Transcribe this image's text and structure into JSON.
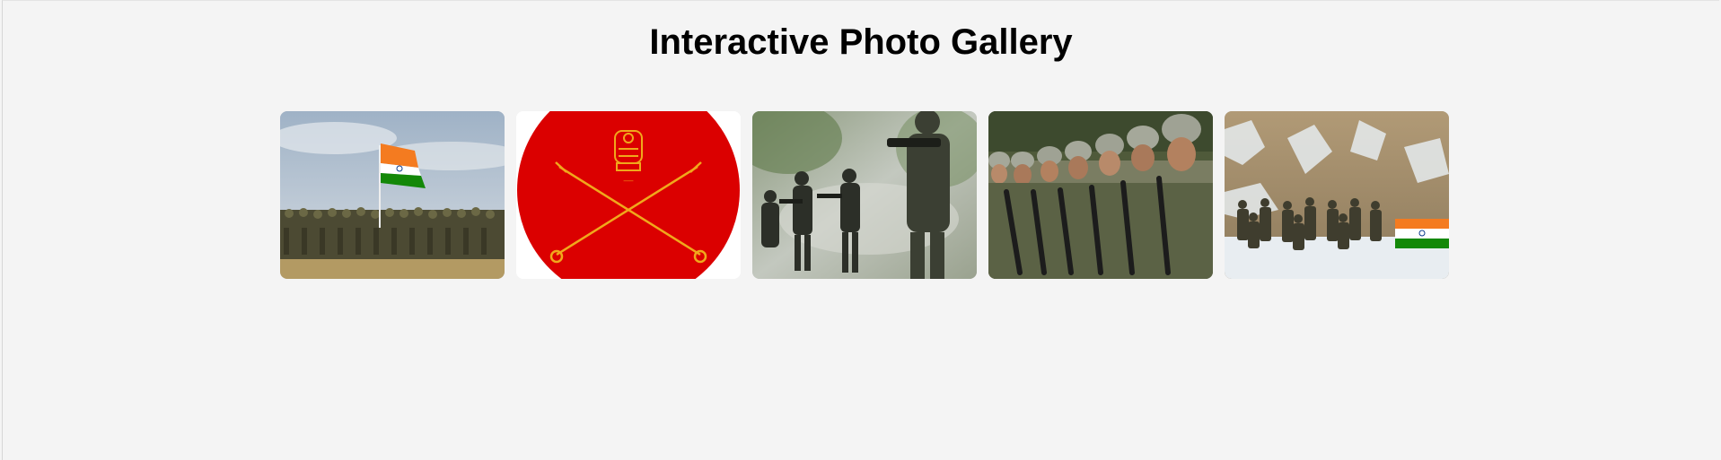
{
  "page": {
    "title": "Interactive Photo Gallery"
  },
  "gallery": {
    "photos": [
      {
        "subject": "soldiers in formation with Indian flag"
      },
      {
        "subject": "Indian Army emblem with crossed swords"
      },
      {
        "subject": "commandos advancing through smoke"
      },
      {
        "subject": "row of soldiers in helmets with rifles"
      },
      {
        "subject": "troops in snowy mountains holding Indian flag"
      }
    ]
  },
  "colors": {
    "background": "#f4f4f4",
    "emblem_red": "#db0000",
    "emblem_gold": "#f0a81c",
    "saffron": "#f47b20",
    "green": "#138808"
  }
}
